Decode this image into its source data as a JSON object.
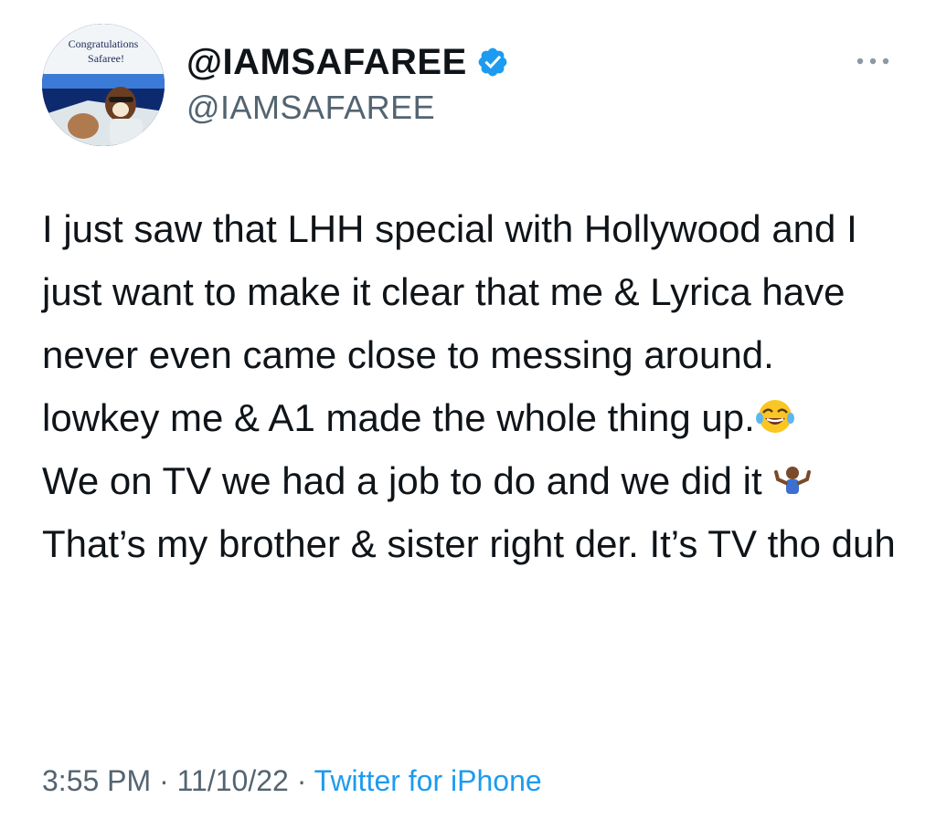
{
  "tweet": {
    "avatar": {
      "caption_line1": "Congratulations",
      "caption_line2": "Safaree!"
    },
    "display_name": "@IAMSAFAREE",
    "handle": "@IAMSAFAREE",
    "verified": true,
    "more_icon": "more-options-icon",
    "text": {
      "part1": "I just saw that LHH special with Hollywood and I just want to make it clear that me & Lyrica have never even came close to messing around. lowkey me & A1 made the whole thing up.",
      "emoji1": "face-with-tears-of-joy-icon",
      "part2": "We on TV we had a job to do and we did it ",
      "emoji2": "person-shrugging-icon",
      "part3": " That’s my brother & sister right der. It’s TV tho duh"
    },
    "meta": {
      "time": "3:55 PM",
      "sep1": " · ",
      "date": "11/10/22",
      "sep2": " · ",
      "source": "Twitter for iPhone"
    }
  },
  "colors": {
    "text": "#0f1419",
    "secondary": "#536471",
    "link": "#1d9bf0",
    "verified": "#1d9bf0"
  }
}
